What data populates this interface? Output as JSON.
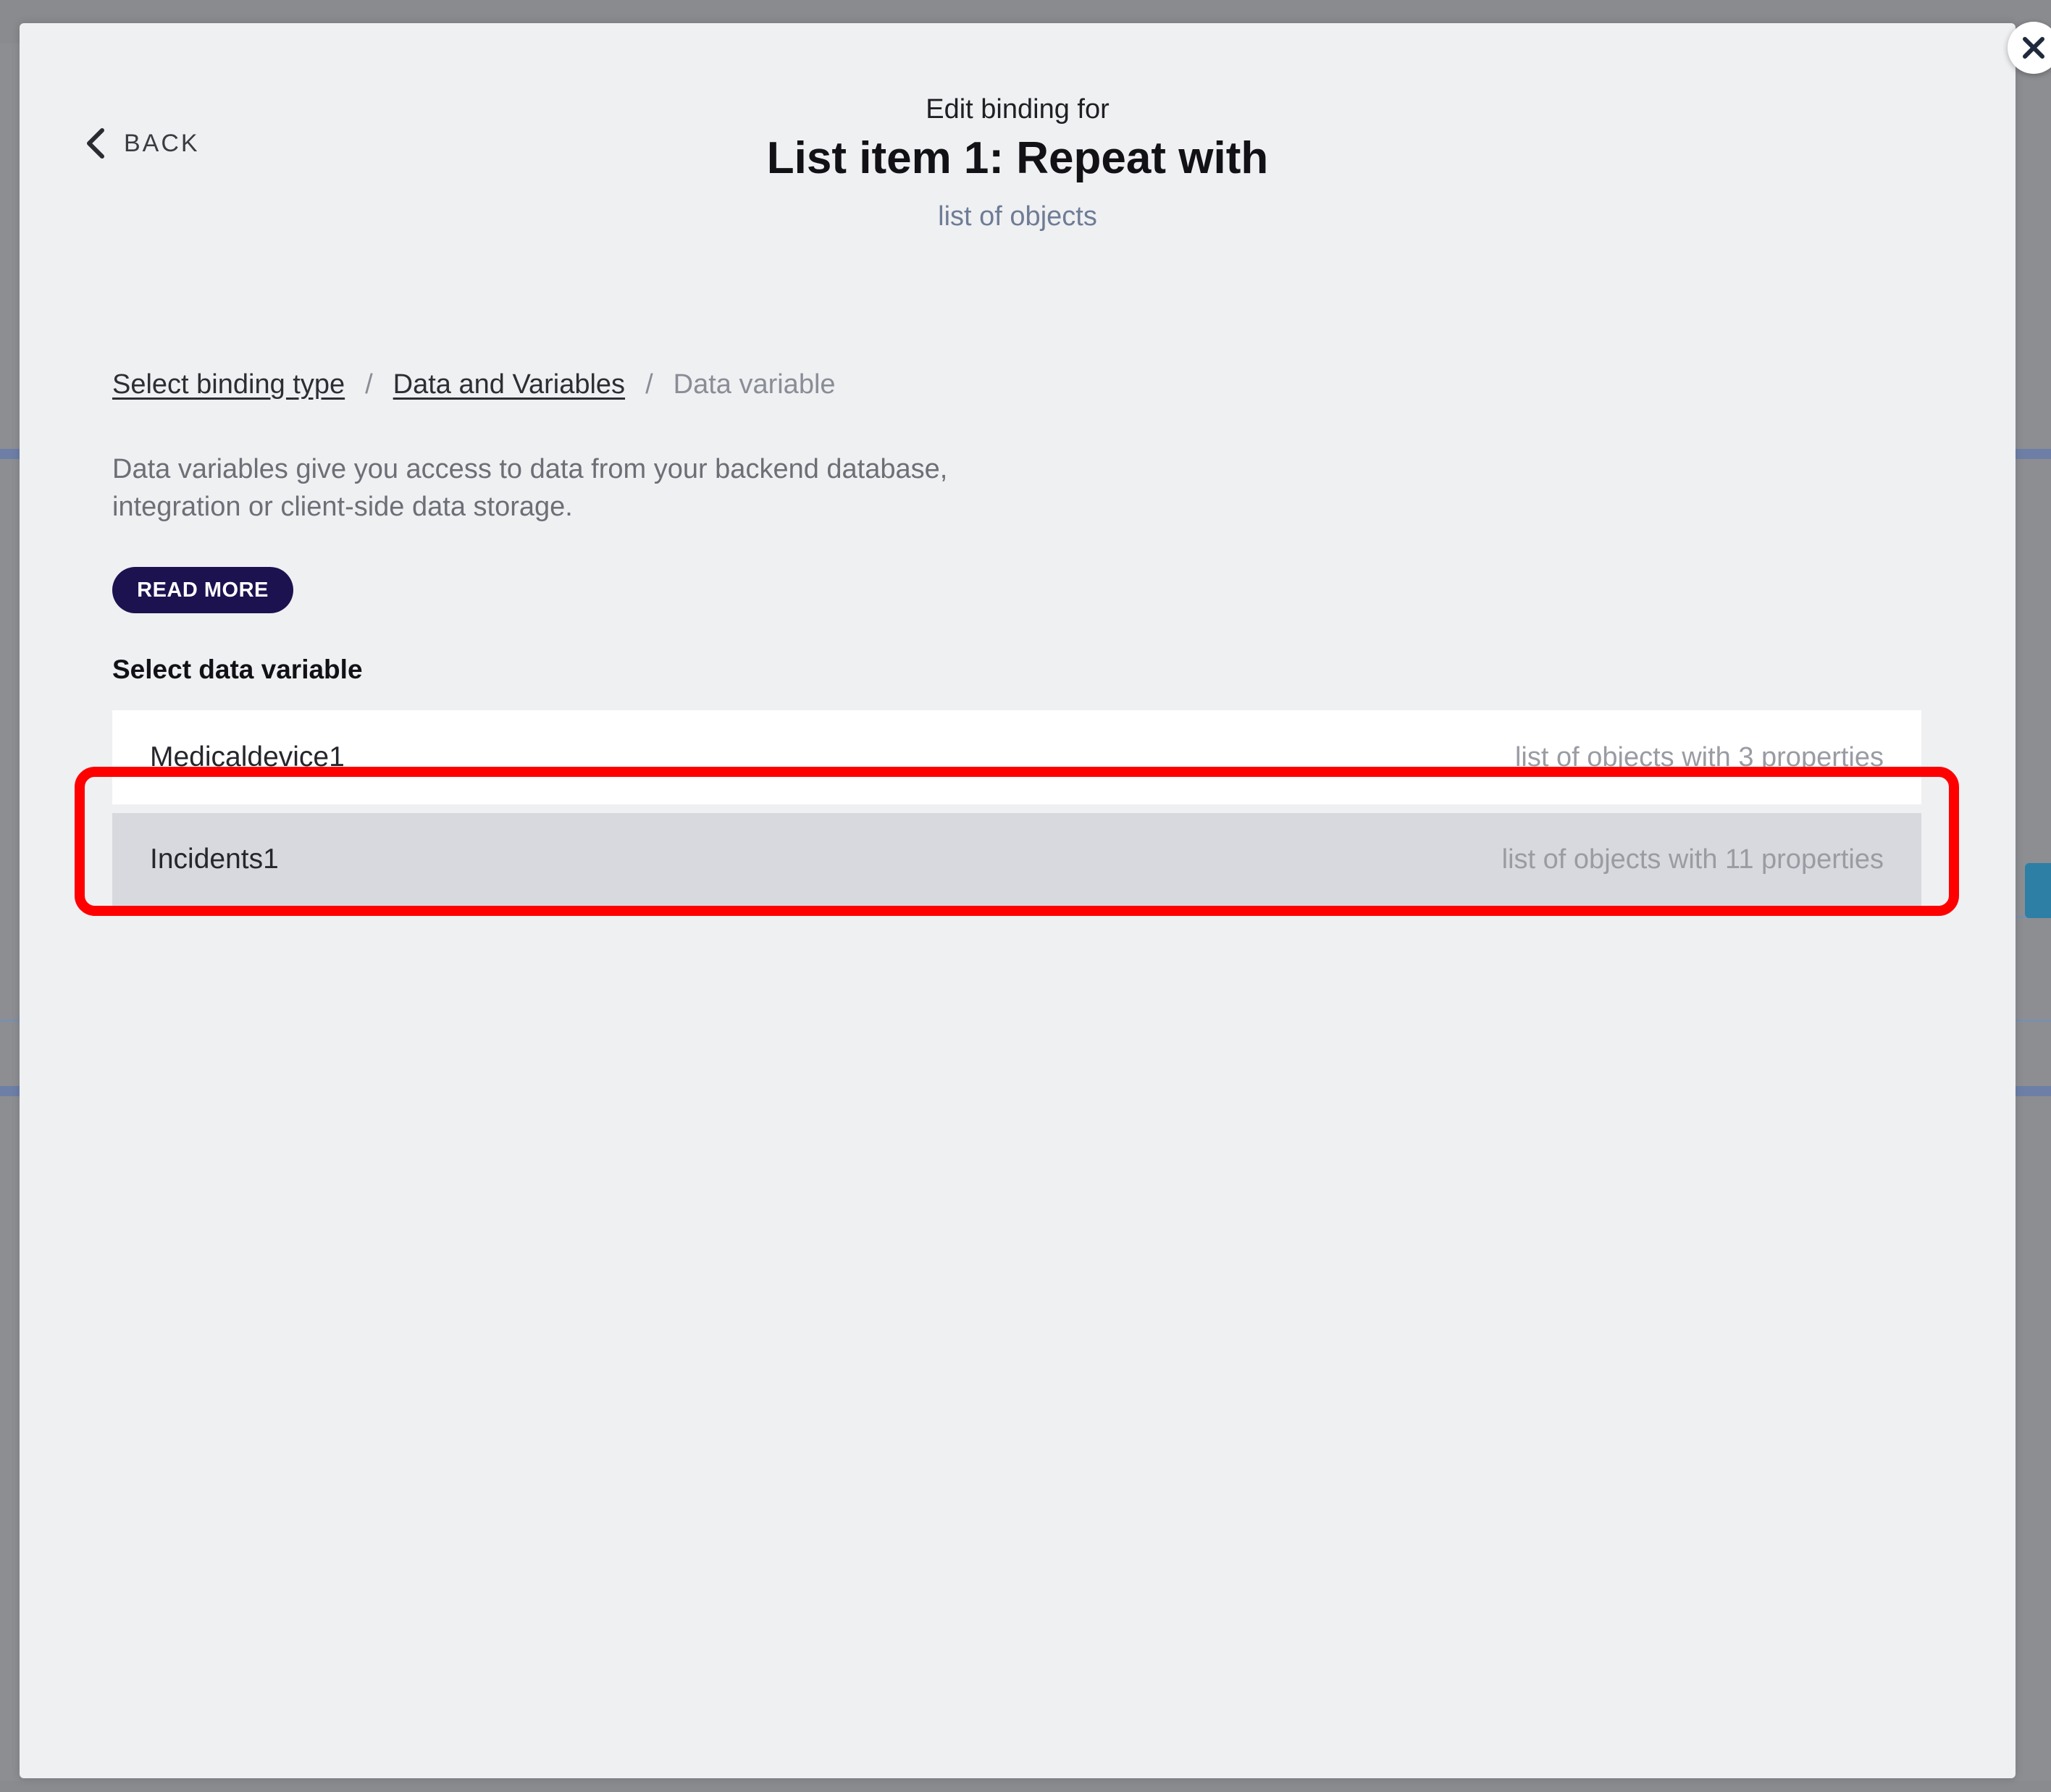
{
  "modal": {
    "close_icon": "close-icon",
    "back_label": "BACK",
    "back_icon": "chevron-left-icon"
  },
  "header": {
    "pre_title": "Edit binding for",
    "title": "List item 1: Repeat with",
    "subtitle": "list of objects"
  },
  "breadcrumb": {
    "items": [
      "Select binding type",
      "Data and Variables",
      "Data variable"
    ],
    "separator": "/"
  },
  "description": {
    "line1": "Data variables give you access to data from your backend database,",
    "line2": "integration or client-side data storage."
  },
  "read_more_label": "READ MORE",
  "section_label": "Select data variable",
  "variables": [
    {
      "name": "Medicaldevice1",
      "type": "list of objects with 3 properties"
    },
    {
      "name": "Incidents1",
      "type": "list of objects with 11 properties"
    }
  ],
  "colors": {
    "accent_button": "#1c1250",
    "highlight": "#ff0000",
    "modal_bg": "#eff0f2",
    "selected_row": "#d8d9de"
  }
}
